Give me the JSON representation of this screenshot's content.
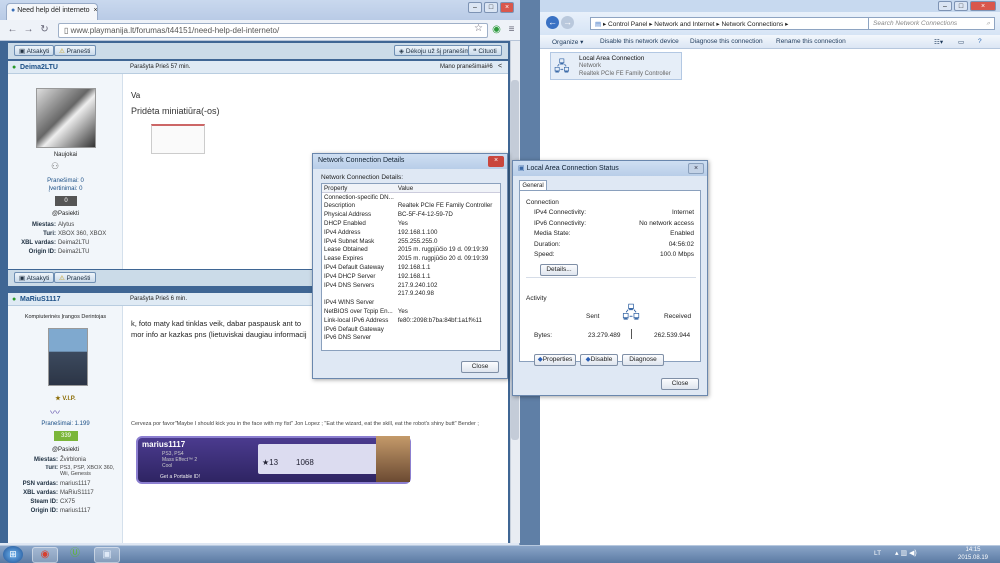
{
  "chrome": {
    "tab_title": "Need help dėl interneto",
    "url": "www.playmanija.lt/forumas/t44151/need-help-del-interneto/",
    "toolbar_top": {
      "reply": "Atsakyti",
      "report": "Pranešti",
      "thanks": "Dėkoju už šį pranešimą",
      "quote": "Cituoti"
    },
    "toolbar_mid": {
      "reply": "Atsakyti",
      "report": "Pranešti"
    },
    "post1": {
      "username": "Deima2LTU",
      "posted": "Parašyta Prieš 57 min.",
      "my_posts": "Mano pranešimai",
      "post_num": "#6",
      "text_short": "Va",
      "attachment_label": "Pridėta miniatiūra(-os)",
      "rank": "Naujokai",
      "stats_posts": "Pranešimai: 0",
      "stats_thanks": "Įvertinimai: 0",
      "rep": "0",
      "pm": "@Pasiekti",
      "fields": [
        {
          "label": "Miestas:",
          "value": "Alytus"
        },
        {
          "label": "Turi:",
          "value": "XBOX 360, XBOX"
        },
        {
          "label": "XBL vardas:",
          "value": "Deima2LTU"
        },
        {
          "label": "Origin ID:",
          "value": "Deima2LTU"
        }
      ]
    },
    "post2": {
      "username": "MaRiuS1117",
      "posted": "Parašyta Prieš 6 min.",
      "rank": "Kompiuterinės Įrangos Derintojas",
      "vip": "V.I.P.",
      "posts_count": "Pranešimai: 1.199",
      "rep": "339",
      "pm": "@Pasiekti",
      "text_line1": "k, foto maty kad tinklas veik, dabar paspausk ant to",
      "text_line2": "mor info ar kazkas pns (lietuviskai daugiau informacij",
      "signature": "Cerveza por favor\"Maybe I should kick you in the face with my fist\" Jon Lopez ; \"Eat the wizard, eat the skill, eat the robot's shiny butt\" Bender ;",
      "card_name": "marius1117",
      "card_games": "PS3, PS4",
      "card_game": "Mass Effect™ 2",
      "card_rating": "Cool",
      "card_level": "13",
      "card_points": "1068",
      "card_footer": "Get a Portable ID!",
      "fields": [
        {
          "label": "Miestas:",
          "value": "Žvirblonia"
        },
        {
          "label": "Turi:",
          "value": "PS3, PSP, XBOX 360, Wii, Genesis"
        },
        {
          "label": "PSN vardas:",
          "value": "marius1117"
        },
        {
          "label": "XBL vardas:",
          "value": "MaRiuS1117"
        },
        {
          "label": "Steam ID:",
          "value": "CX75"
        },
        {
          "label": "Origin ID:",
          "value": "marius1117"
        }
      ]
    }
  },
  "explorer": {
    "breadcrumb": "▸ Control Panel ▸ Network and Internet ▸ Network Connections ▸",
    "search_placeholder": "Search Network Connections",
    "commands": [
      "Organize ▾",
      "Disable this network device",
      "Diagnose this connection",
      "Rename this connection"
    ],
    "adapter": {
      "name": "Local Area Connection",
      "network": "Network",
      "device": "Realtek PCIe FE Family Controller"
    }
  },
  "details_dialog": {
    "title": "Network Connection Details",
    "label": "Network Connection Details:",
    "col_property": "Property",
    "col_value": "Value",
    "rows": [
      {
        "p": "Connection-specific DN...",
        "v": ""
      },
      {
        "p": "Description",
        "v": "Realtek PCIe FE Family Controller"
      },
      {
        "p": "Physical Address",
        "v": "BC-5F-F4-12-59-7D"
      },
      {
        "p": "DHCP Enabled",
        "v": "Yes"
      },
      {
        "p": "IPv4 Address",
        "v": "192.168.1.100"
      },
      {
        "p": "IPv4 Subnet Mask",
        "v": "255.255.255.0"
      },
      {
        "p": "Lease Obtained",
        "v": "2015 m. rugpjūčio 19 d. 09:19:39"
      },
      {
        "p": "Lease Expires",
        "v": "2015 m. rugpjūčio 20 d. 09:19:39"
      },
      {
        "p": "IPv4 Default Gateway",
        "v": "192.168.1.1"
      },
      {
        "p": "IPv4 DHCP Server",
        "v": "192.168.1.1"
      },
      {
        "p": "IPv4 DNS Servers",
        "v": "217.9.240.102"
      },
      {
        "p": "",
        "v": "217.9.240.98"
      },
      {
        "p": "IPv4 WINS Server",
        "v": ""
      },
      {
        "p": "NetBIOS over Tcpip En...",
        "v": "Yes"
      },
      {
        "p": "Link-local IPv6 Address",
        "v": "fe80::2098:b7ba:84bf:1a1f%11"
      },
      {
        "p": "IPv6 Default Gateway",
        "v": ""
      },
      {
        "p": "IPv6 DNS Server",
        "v": ""
      }
    ],
    "close": "Close"
  },
  "status_dialog": {
    "title": "Local Area Connection Status",
    "tab": "General",
    "connection_heading": "Connection",
    "rows": [
      {
        "k": "IPv4 Connectivity:",
        "v": "Internet"
      },
      {
        "k": "IPv6 Connectivity:",
        "v": "No network access"
      },
      {
        "k": "Media State:",
        "v": "Enabled"
      },
      {
        "k": "Duration:",
        "v": "04:56:02"
      },
      {
        "k": "Speed:",
        "v": "100.0 Mbps"
      }
    ],
    "details_btn": "Details...",
    "activity_heading": "Activity",
    "sent_label": "Sent",
    "received_label": "Received",
    "bytes_label": "Bytes:",
    "bytes_sent": "23.279.489",
    "bytes_received": "262.539.944",
    "properties_btn": "Properties",
    "disable_btn": "Disable",
    "diagnose_btn": "Diagnose",
    "close": "Close"
  },
  "taskbar": {
    "lang": "LT",
    "time": "14:15",
    "date": "2015.08.19"
  }
}
